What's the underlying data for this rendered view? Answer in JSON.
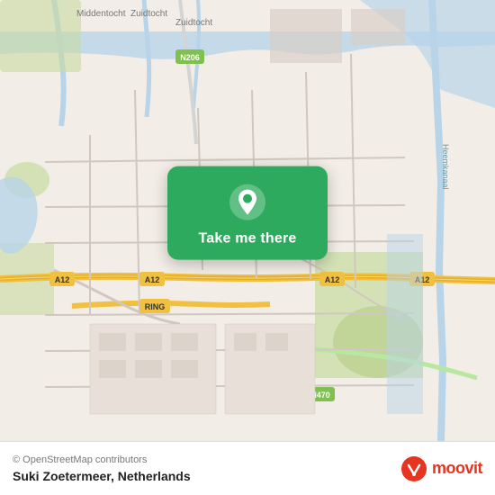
{
  "map": {
    "attribution": "© OpenStreetMap contributors",
    "location_name": "Suki Zoetermeer, Netherlands",
    "overlay": {
      "button_label": "Take me there",
      "pin_color": "#ffffff",
      "bg_color": "#2eaa5e"
    }
  },
  "moovit": {
    "logo_text": "moovit",
    "logo_color": "#e8331e"
  }
}
